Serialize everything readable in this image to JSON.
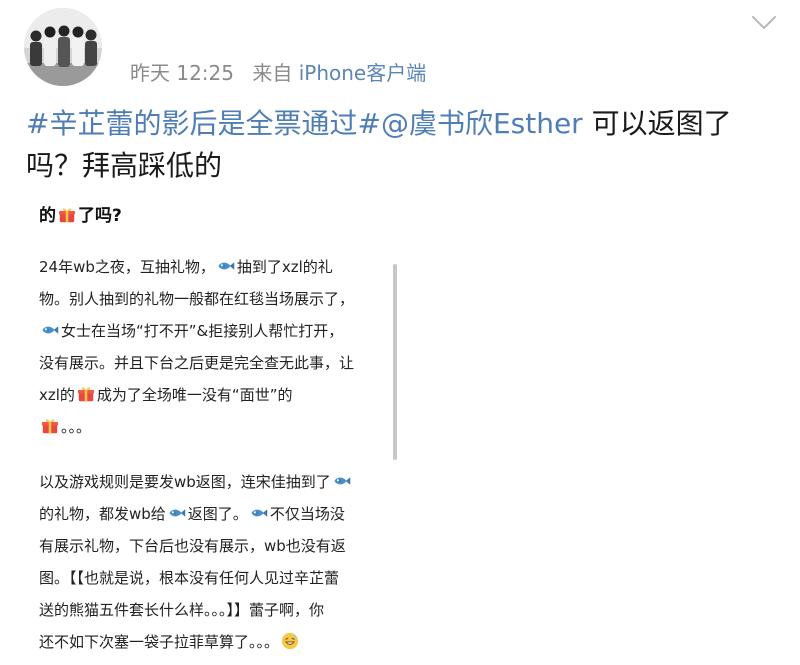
{
  "post": {
    "time": "昨天 12:25",
    "source_prefix": "来自",
    "source": "iPhone客户端",
    "hashtag": "#辛芷蕾的影后是全票通过#",
    "mention": "@虞书欣Esther",
    "text_line1_rest": " 可以返图了",
    "text_line2": "吗？拜高踩低的"
  },
  "image_card": {
    "heading_prefix": "的",
    "heading_suffix": "了吗?",
    "p1": {
      "l1a": "24年wb之夜，互抽礼物，",
      "l1b": "抽到了xzl的礼",
      "l2": "物。别人抽到的礼物一般都在红毯当场展示了，",
      "l3": "女士在当场“打不开”&拒接别人帮忙打开，",
      "l4": "没有展示。并且下台之后更是完全查无此事，让",
      "l5a": "xzl的",
      "l5b": "成为了全场唯一没有“面世”的",
      "l6": "。。。"
    },
    "p2": {
      "l1": "以及游戏规则是要发wb返图，连宋佳抽到了",
      "l2a": "的礼物，都发wb给",
      "l2b": "返图了。",
      "l2c": "不仅当场没",
      "l3": "有展示礼物，下台后也没有展示，wb也没有返",
      "l4": "图。【【也就是说，根本没有任何人见过辛芷蕾",
      "l5": "送的熊猫五件套长什么样。。。】】蕾子啊，你",
      "l6": "还不如下次塞一袋子拉菲草算了。。。"
    }
  },
  "icons": {
    "gift": "gift-emoji",
    "fish": "fish-emoji",
    "sweat": "sweat-smile-emoji",
    "chevron": "chevron-down-icon"
  },
  "colors": {
    "link": "#4f7db5",
    "meta": "#8a8a8a",
    "source_link": "#5d84b7"
  }
}
